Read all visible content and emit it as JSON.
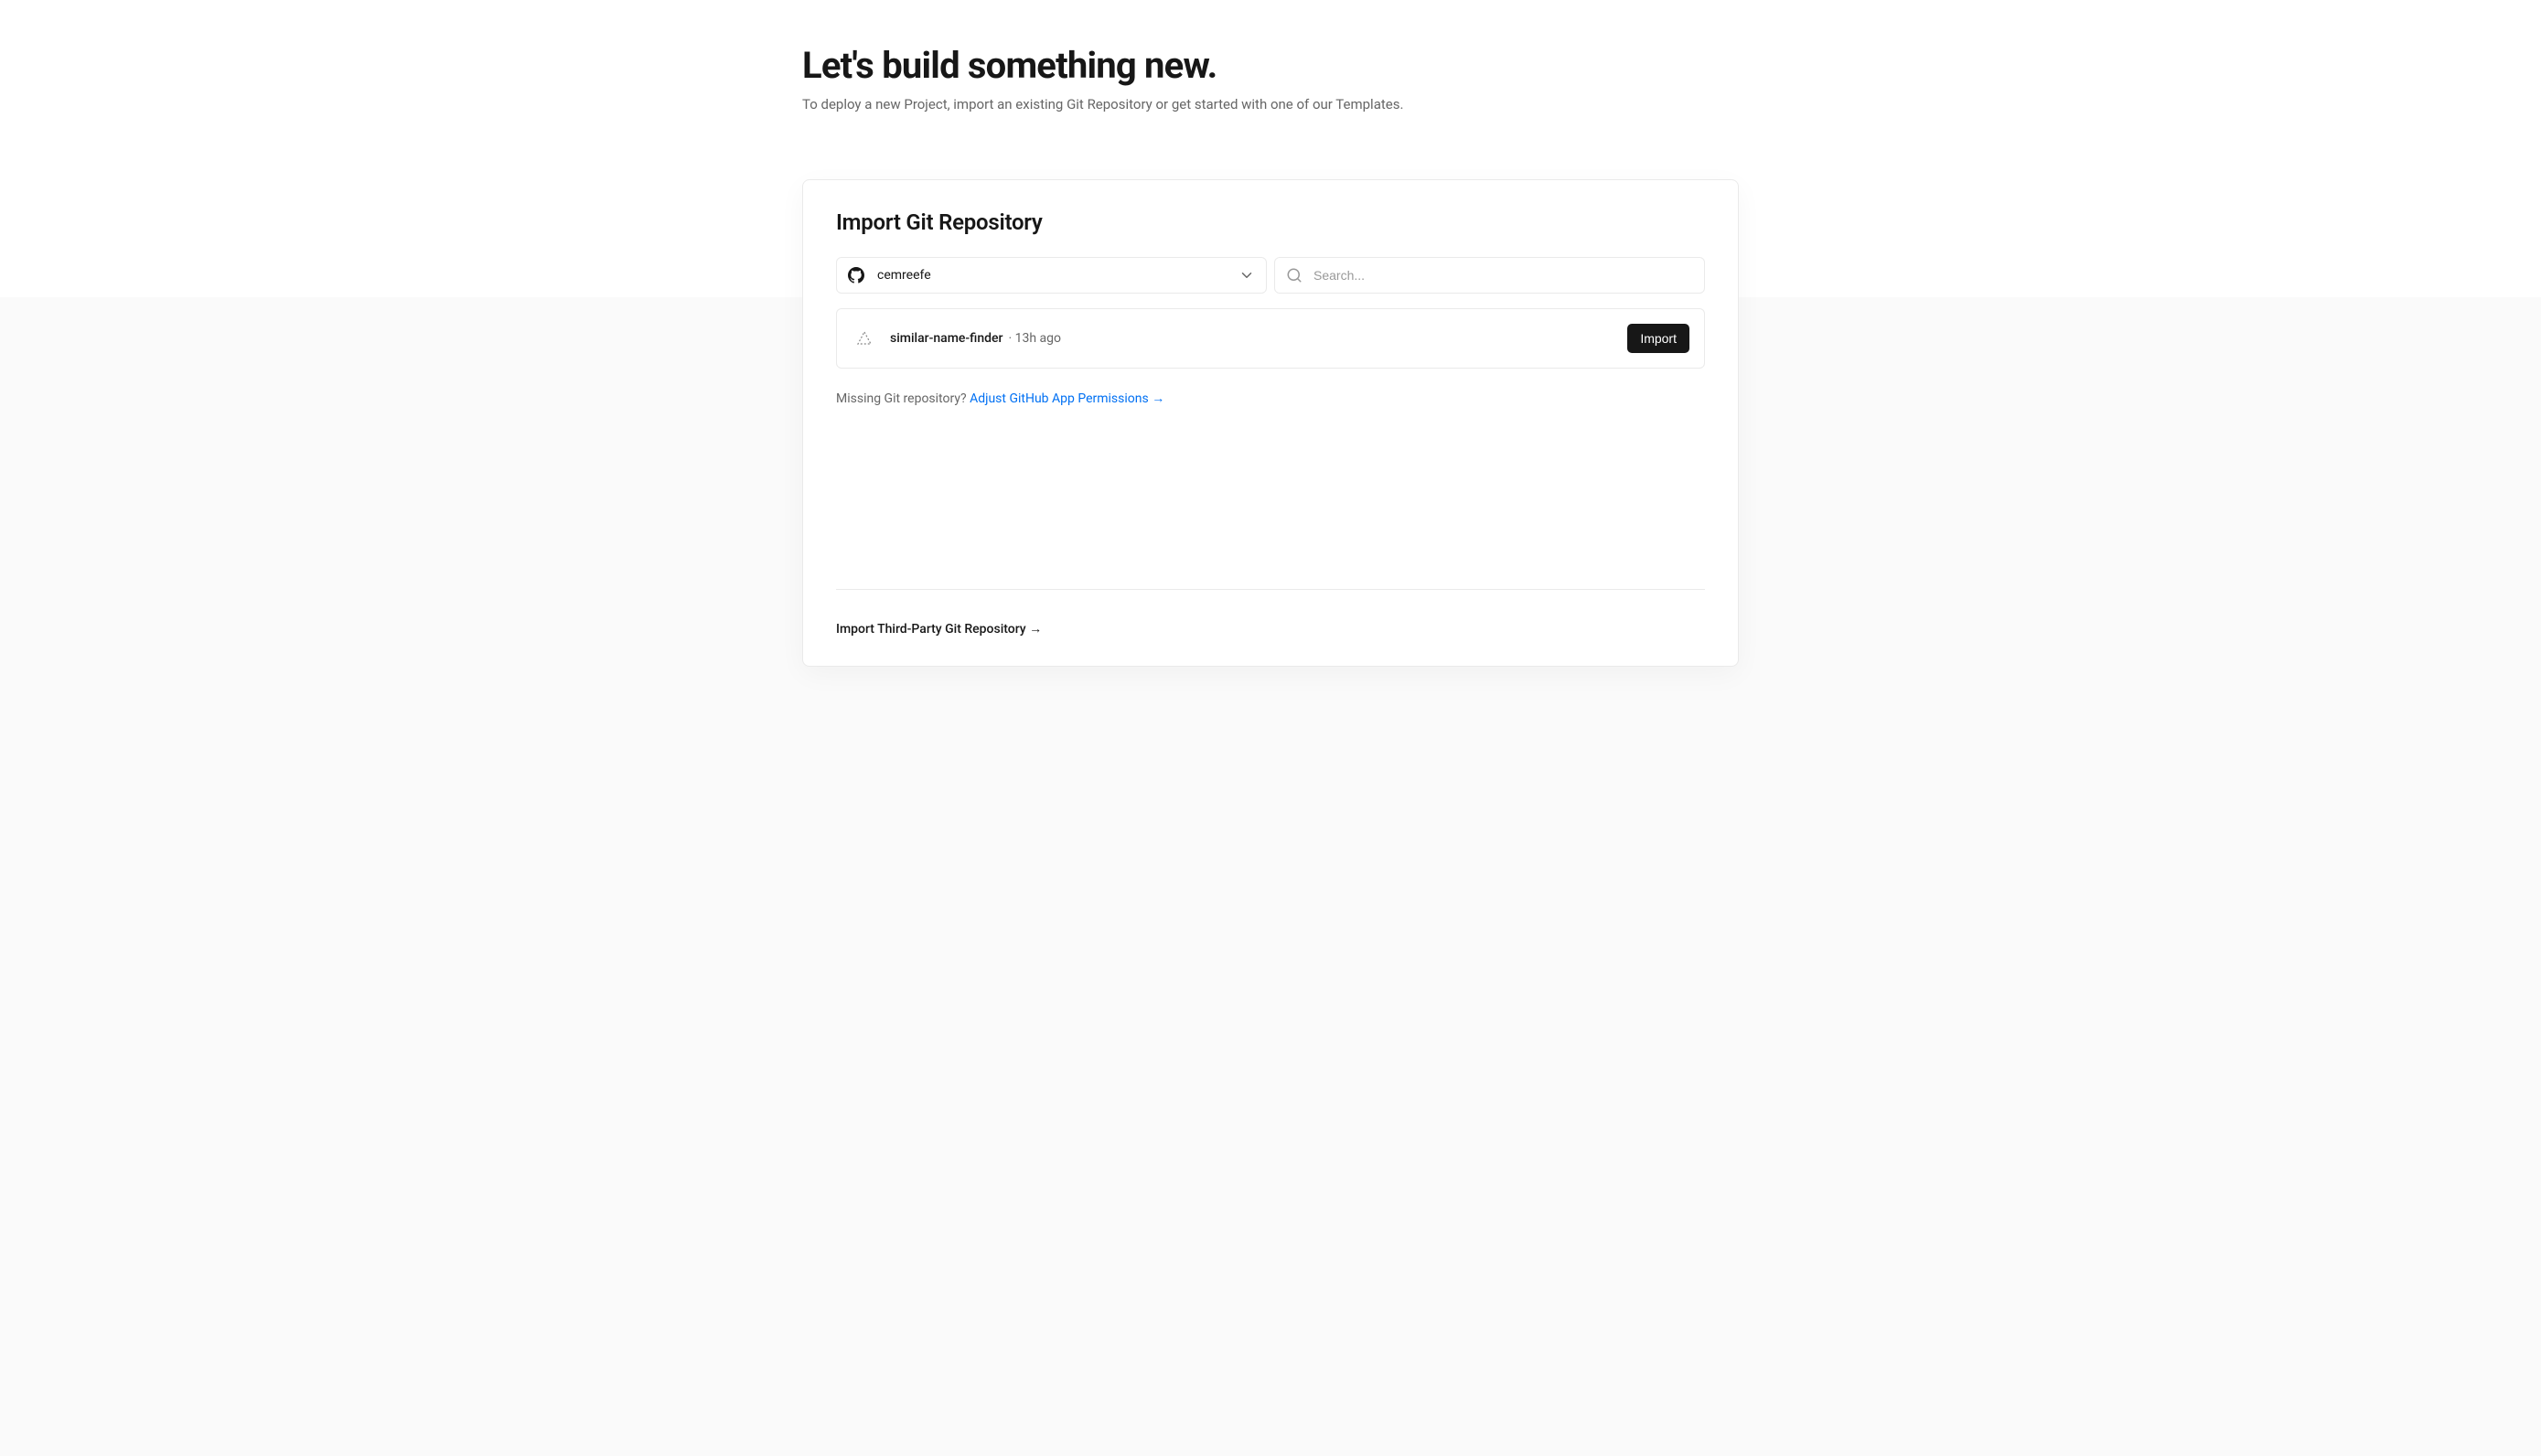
{
  "header": {
    "title": "Let's build something new.",
    "subtitle": "To deploy a new Project, import an existing Git Repository or get started with one of our Templates."
  },
  "import_card": {
    "title": "Import Git Repository",
    "scope": {
      "provider": "github",
      "name": "cemreefe"
    },
    "search": {
      "placeholder": "Search..."
    },
    "repos": [
      {
        "name": "similar-name-finder",
        "time_ago": "13h ago",
        "import_label": "Import"
      }
    ],
    "missing_text": "Missing Git repository? ",
    "adjust_link": "Adjust GitHub App Permissions →",
    "third_party_link": "Import Third-Party Git Repository →"
  }
}
